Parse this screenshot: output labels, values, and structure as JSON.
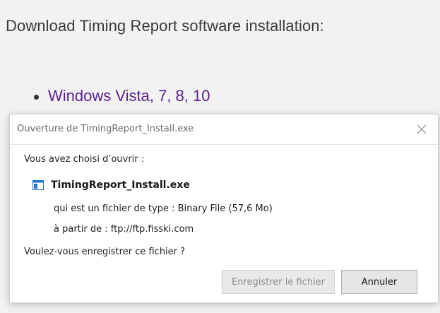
{
  "page": {
    "heading": "Download Timing Report software installation:",
    "downloads": [
      {
        "label": "Windows Vista, 7, 8, 10"
      }
    ]
  },
  "dialog": {
    "title": "Ouverture de TimingReport_Install.exe",
    "prompt": "Vous avez choisi d’ouvrir :",
    "file_name": "TimingReport_Install.exe",
    "file_icon": "application-window-icon",
    "file_type_line": "qui est un fichier de type : Binary File (57,6 Mo)",
    "source_line": "à partir de : ftp://ftp.fisski.com",
    "question": "Voulez-vous enregistrer ce fichier ?",
    "buttons": {
      "save_label": "Enregistrer le fichier",
      "cancel_label": "Annuler"
    }
  },
  "colors": {
    "link": "#5b1f90",
    "page_background": "#f2f2f2",
    "dialog_background": "#ffffff",
    "disabled_text": "#8d8d8d"
  }
}
